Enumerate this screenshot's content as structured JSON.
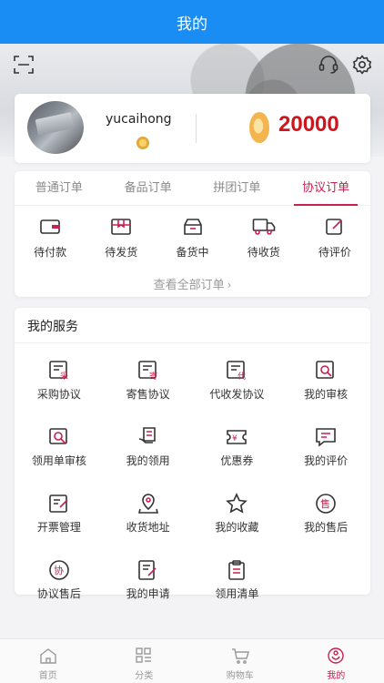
{
  "header": {
    "title": "我的"
  },
  "profile": {
    "username": "yucaihong",
    "balance": "20000"
  },
  "orders": {
    "tabs": [
      {
        "label": "普通订单",
        "active": false
      },
      {
        "label": "备品订单",
        "active": false
      },
      {
        "label": "拼团订单",
        "active": false
      },
      {
        "label": "协议订单",
        "active": true
      }
    ],
    "statuses": [
      {
        "label": "待付款",
        "icon": "wallet-icon"
      },
      {
        "label": "待发货",
        "icon": "package-icon"
      },
      {
        "label": "备货中",
        "icon": "box-icon"
      },
      {
        "label": "待收货",
        "icon": "truck-icon"
      },
      {
        "label": "待评价",
        "icon": "edit-icon"
      }
    ],
    "view_all": "查看全部订单",
    "view_all_chevron": "›"
  },
  "services": {
    "title": "我的服务",
    "items": [
      {
        "label": "采购协议",
        "icon": "purchase-agreement-icon"
      },
      {
        "label": "寄售协议",
        "icon": "consignment-agreement-icon"
      },
      {
        "label": "代收发协议",
        "icon": "agency-agreement-icon"
      },
      {
        "label": "我的审核",
        "icon": "review-icon"
      },
      {
        "label": "领用单审核",
        "icon": "requisition-review-icon"
      },
      {
        "label": "我的领用",
        "icon": "my-requisition-icon"
      },
      {
        "label": "优惠券",
        "icon": "coupon-icon"
      },
      {
        "label": "我的评价",
        "icon": "comment-icon"
      },
      {
        "label": "开票管理",
        "icon": "invoice-icon"
      },
      {
        "label": "收货地址",
        "icon": "address-icon"
      },
      {
        "label": "我的收藏",
        "icon": "star-icon"
      },
      {
        "label": "我的售后",
        "icon": "after-sales-icon"
      },
      {
        "label": "协议售后",
        "icon": "agreement-after-sales-icon"
      },
      {
        "label": "我的申请",
        "icon": "application-icon"
      },
      {
        "label": "领用清单",
        "icon": "clipboard-icon"
      }
    ]
  },
  "tabbar": {
    "items": [
      {
        "label": "首页",
        "icon": "home-icon",
        "active": false
      },
      {
        "label": "分类",
        "icon": "category-icon",
        "active": false
      },
      {
        "label": "购物车",
        "icon": "cart-icon",
        "active": false
      },
      {
        "label": "我的",
        "icon": "profile-icon",
        "active": true
      }
    ]
  },
  "colors": {
    "header_bg": "#1a8df5",
    "accent": "#c8204f",
    "price": "#d0141c"
  }
}
